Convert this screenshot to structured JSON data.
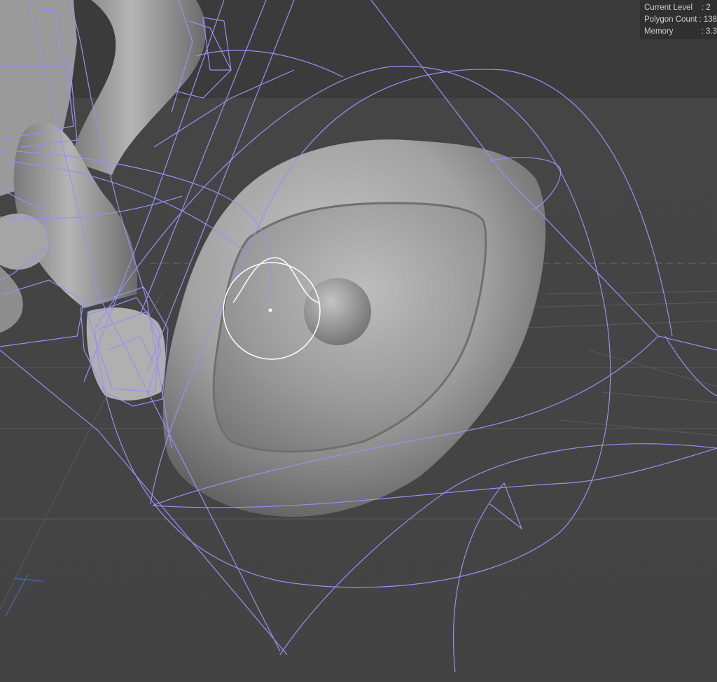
{
  "stats": {
    "current_level": {
      "label": "Current Level",
      "value": ": 2"
    },
    "polygon_count": {
      "label": "Polygon Count",
      "value": ": 138"
    },
    "memory": {
      "label": "Memory",
      "value": ": 3.3"
    }
  },
  "colors": {
    "background": "#3d3d3d",
    "wireframe": "#9a8ff0",
    "mesh": "#9b9b9b",
    "brush": "#ffffff"
  }
}
